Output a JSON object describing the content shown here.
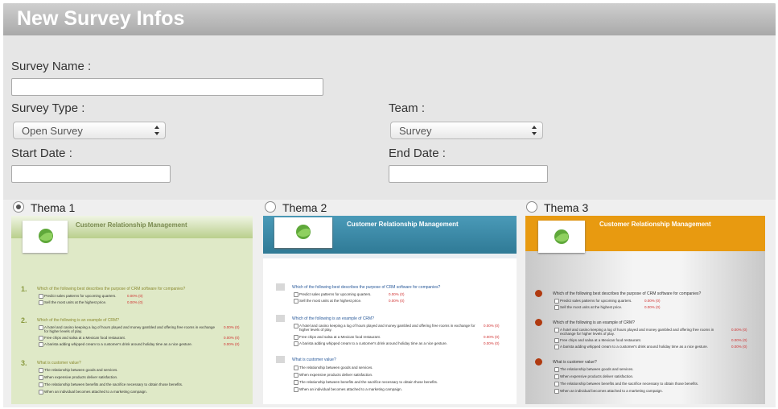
{
  "panel": {
    "title": "New Survey Infos"
  },
  "form": {
    "survey_name_label": "Survey Name :",
    "survey_name_value": "",
    "survey_type_label": "Survey Type :",
    "survey_type_value": "Open Survey",
    "team_label": "Team :",
    "team_value": "Survey",
    "start_date_label": "Start Date :",
    "start_date_value": "",
    "end_date_label": "End Date :",
    "end_date_value": ""
  },
  "themes": [
    {
      "label": "Thema 1",
      "selected": true
    },
    {
      "label": "Thema 2",
      "selected": false
    },
    {
      "label": "Thema 3",
      "selected": false
    }
  ],
  "preview": {
    "title": "Customer Relationship Management",
    "q1": "Which of the following best describes the purpose of CRM software for companies?",
    "q1_opt1": "Predict sales patterns for upcoming quarters.",
    "q1_opt2": "Sell the most units at the highest price.",
    "q2": "Which of the following is an example of CRM?",
    "q2_opt1": "A hotel and casino keeping a log of hours played and money gambled and offering free rooms in exchange for higher levels of play.",
    "q2_opt2": "Free chips and salsa at a Mexican food restaurant.",
    "q2_opt3": "A barista adding whipped cream to a customer's drink around holiday time as a nice gesture.",
    "q3": "What is customer value?",
    "q3_opt1": "The relationship between goods and services.",
    "q3_opt2": "When expensive products deliver satisfaction.",
    "q3_opt3": "The relationship between benefits and the sacrifice necessary to obtain those benefits.",
    "q3_opt4": "When an individual becomes attached to a marketing campaign.",
    "pct": "0.00%  (0)"
  },
  "colors": {
    "theme1_header": "#b9cf8c",
    "theme2_header": "#3d8ca8",
    "theme3_header": "#e89a10",
    "logo_green": "#5fa83a"
  }
}
